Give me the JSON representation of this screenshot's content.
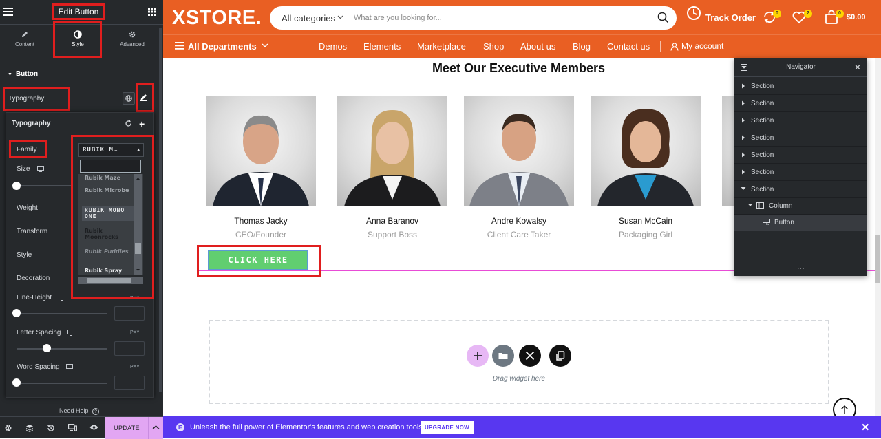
{
  "editor": {
    "title": "Edit Button",
    "tabs": [
      {
        "label": "Content",
        "icon": "pencil-icon"
      },
      {
        "label": "Style",
        "icon": "half-circle-icon"
      },
      {
        "label": "Advanced",
        "icon": "gear-icon"
      }
    ],
    "active_tab": "Style",
    "section_title": "Button",
    "typography_label": "Typography",
    "typography_popover": {
      "title": "Typography",
      "family_label": "Family",
      "family_value": "RUBIK M…",
      "font_options": [
        "Rubik Maze",
        "Rubik Microbe",
        "RUBIK MONO ONE",
        "Rubik Moonrocks",
        "Rubik Puddles",
        "Rubik Spray Paint"
      ],
      "highlighted_font": "RUBIK MONO ONE",
      "size_label": "Size",
      "weight_label": "Weight",
      "transform_label": "Transform",
      "style_label": "Style",
      "decoration_label": "Decoration",
      "line_height_label": "Line-Height",
      "line_height_unit": "PX",
      "letter_spacing_label": "Letter Spacing",
      "letter_spacing_unit": "PX",
      "word_spacing_label": "Word Spacing",
      "word_spacing_unit": "PX"
    },
    "need_help": "Need Help",
    "update_label": "UPDATE"
  },
  "site": {
    "logo": "XSTORE.",
    "search": {
      "category": "All categories",
      "placeholder": "What are you looking for..."
    },
    "track_order": "Track Order",
    "compare_count": "0",
    "wishlist_count": "2",
    "cart_count": "0",
    "cart_total": "$0.00",
    "all_departments": "All Departments",
    "nav_links": [
      "Demos",
      "Elements",
      "Marketplace",
      "Shop",
      "About us",
      "Blog",
      "Contact us"
    ],
    "my_account": "My account"
  },
  "content": {
    "section_title": "Meet Our Executive Members",
    "members": [
      {
        "name": "Thomas Jacky",
        "role": "CEO/Founder"
      },
      {
        "name": "Anna Baranov",
        "role": "Support Boss"
      },
      {
        "name": "Andre Kowalsy",
        "role": "Client Care Taker"
      },
      {
        "name": "Susan McCain",
        "role": "Packaging Girl"
      }
    ],
    "button_label": "CLICK HERE",
    "drop_zone_text": "Drag widget here"
  },
  "navigator": {
    "title": "Navigator",
    "items": [
      {
        "label": "Section"
      },
      {
        "label": "Section"
      },
      {
        "label": "Section"
      },
      {
        "label": "Section"
      },
      {
        "label": "Section"
      },
      {
        "label": "Section"
      },
      {
        "label": "Section"
      },
      {
        "label": "Column"
      },
      {
        "label": "Button"
      }
    ]
  },
  "promo": {
    "text": "Unleash the full power of Elementor's features and web creation tools.",
    "button": "UPGRADE NOW"
  },
  "colors": {
    "brand_orange": "#e95f23",
    "editor_dark": "#26292c",
    "button_green": "#61ce70",
    "promo_purple": "#5837f0",
    "highlight_red": "#e01e1e"
  }
}
